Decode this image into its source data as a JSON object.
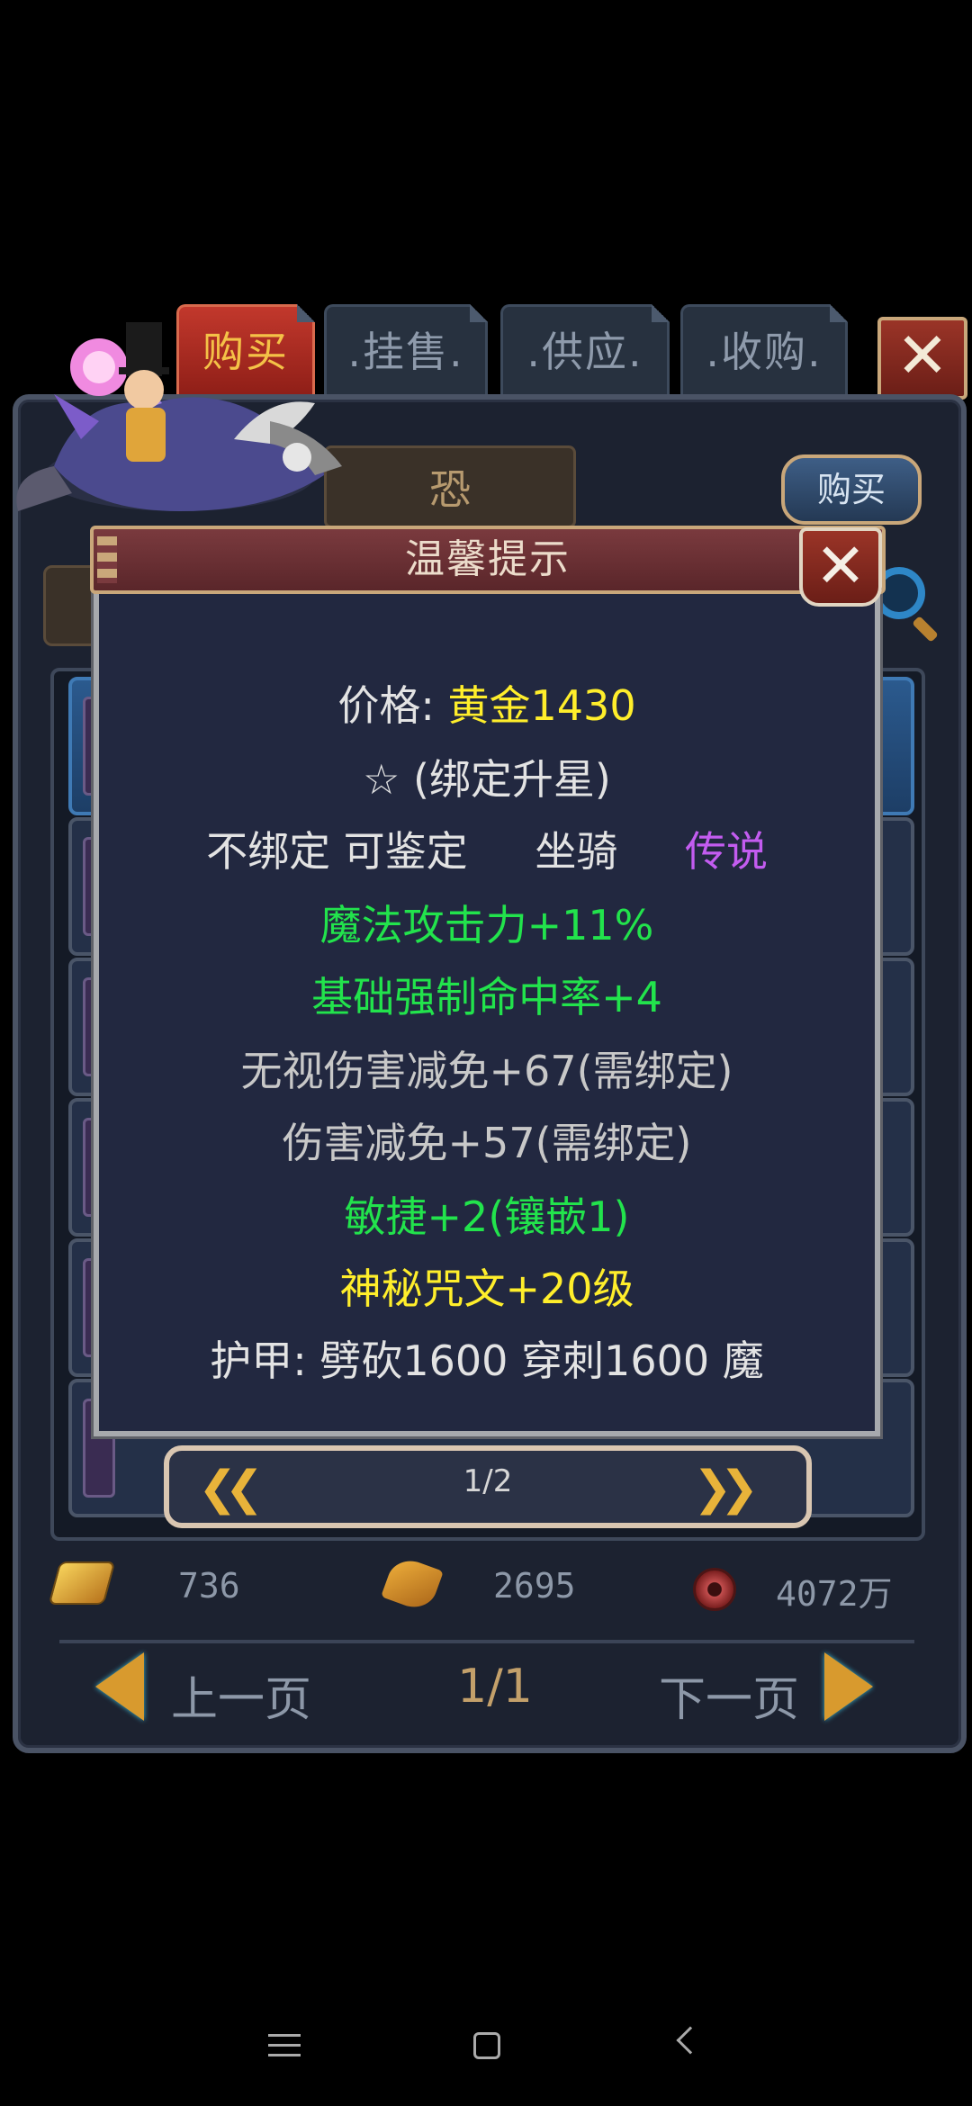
{
  "tabs": [
    {
      "label": "购买",
      "active": true
    },
    {
      "label": ".挂售.",
      "active": false
    },
    {
      "label": ".供应.",
      "active": false
    },
    {
      "label": ".收购.",
      "active": false
    }
  ],
  "subtab_label": "恐",
  "buy_button": "购买",
  "dialog": {
    "title": "温馨提示",
    "price_label": "价格: ",
    "price_value": "黄金1430",
    "star_line": "☆ (绑定升星)",
    "status_left": "不绑定 可鉴定",
    "status_type": "坐骑",
    "status_rarity": "传说",
    "stat_magic_attack": "魔法攻击力+11%",
    "stat_hit_rate": "基础强制命中率+4",
    "stat_ignore_reduction": "无视伤害减免+67(需绑定)",
    "stat_reduction": "伤害减免+57(需绑定)",
    "stat_agility": "敏捷+2(镶嵌1)",
    "stat_rune": "神秘咒文+20级",
    "armor_line": "护甲:  劈砍1600  穿刺1600  魔",
    "pager": {
      "current": "1/2",
      "prev_icon": "double-left-chevron",
      "next_icon": "double-right-chevron"
    }
  },
  "currency": {
    "gold": "736",
    "leaf": "2695",
    "coin": "4072万"
  },
  "pager": {
    "prev": "上一页",
    "page": "1/1",
    "next": "下一页"
  },
  "colors": {
    "yellow": "#ffee2b",
    "green": "#22e34c",
    "purple": "#c35cf0",
    "gold_text": "#c3a06a"
  }
}
